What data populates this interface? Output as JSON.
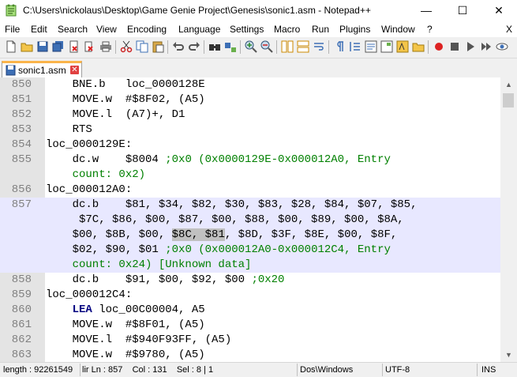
{
  "window": {
    "title": "C:\\Users\\nickolaus\\Desktop\\Game Genie Project\\Genesis\\sonic1.asm - Notepad++",
    "minimize": "—",
    "maximize": "☐",
    "close": "✕"
  },
  "menu": [
    "File",
    "Edit",
    "Search",
    "View",
    "Encoding",
    "Language",
    "Settings",
    "Macro",
    "Run",
    "Plugins",
    "Window",
    "?"
  ],
  "menu_close": "X",
  "tab": {
    "label": "sonic1.asm"
  },
  "lines": [
    {
      "n": "850",
      "parts": [
        {
          "t": "    BNE.b   loc_0000128E"
        }
      ]
    },
    {
      "n": "851",
      "parts": [
        {
          "t": "    MOVE.w  #$8F02, (A5)"
        }
      ]
    },
    {
      "n": "852",
      "parts": [
        {
          "t": "    MOVE.l  (A7)+, D1"
        }
      ]
    },
    {
      "n": "853",
      "parts": [
        {
          "t": "    RTS"
        }
      ]
    },
    {
      "n": "854",
      "parts": [
        {
          "t": "loc_0000129E:"
        }
      ]
    },
    {
      "n": "855",
      "parts": [
        {
          "t": "    dc.w    $8004 "
        },
        {
          "t": ";0x0 (0x0000129E-0x000012A0, Entry",
          "c": "cm"
        }
      ]
    },
    {
      "n": "",
      "parts": [
        {
          "t": "    count: 0x2)",
          "c": "cm"
        }
      ]
    },
    {
      "n": "856",
      "parts": [
        {
          "t": "loc_000012A0:"
        }
      ]
    },
    {
      "n": "857",
      "hl": true,
      "parts": [
        {
          "t": "    dc.b    $81, $34, $82, $30, $83, $28, $84, $07, $85,"
        }
      ]
    },
    {
      "n": "",
      "hl": true,
      "parts": [
        {
          "t": "     $7C, $86, $00, $87, $00, $88, $00, $89, $00, $8A,"
        }
      ]
    },
    {
      "n": "",
      "hl": true,
      "parts": [
        {
          "t": "    $00, $8B, $00, "
        },
        {
          "t": "$8C, $81",
          "c": "sel"
        },
        {
          "t": ", $8D, $3F, $8E, $00, $8F,"
        }
      ]
    },
    {
      "n": "",
      "hl": true,
      "parts": [
        {
          "t": "    $02, $90, $01 "
        },
        {
          "t": ";0x0 (0x000012A0-0x000012C4, Entry",
          "c": "cm"
        }
      ]
    },
    {
      "n": "",
      "hl": true,
      "parts": [
        {
          "t": "    count: 0x24) [Unknown data]",
          "c": "cm"
        }
      ]
    },
    {
      "n": "858",
      "parts": [
        {
          "t": "    dc.b    $91, $00, $92, $00 "
        },
        {
          "t": ";0x20",
          "c": "cm"
        }
      ]
    },
    {
      "n": "859",
      "parts": [
        {
          "t": "loc_000012C4:"
        }
      ]
    },
    {
      "n": "860",
      "parts": [
        {
          "t": "    "
        },
        {
          "t": "LEA",
          "c": "kw"
        },
        {
          "t": " loc_00C00004, A5"
        }
      ]
    },
    {
      "n": "861",
      "parts": [
        {
          "t": "    MOVE.w  #$8F01, (A5)"
        }
      ]
    },
    {
      "n": "862",
      "parts": [
        {
          "t": "    MOVE.l  #$940F93FF, (A5)"
        }
      ]
    },
    {
      "n": "863",
      "parts": [
        {
          "t": "    MOVE.w  #$9780, (A5)"
        }
      ]
    }
  ],
  "status": {
    "length": "length : 92261549",
    "position": "lir Ln : 857    Col : 131    Sel : 8 | 1",
    "eol": "Dos\\Windows",
    "encoding": "UTF-8",
    "mode": "INS"
  },
  "colors": {
    "tab_accent": "#fab44b",
    "highlight_line": "#e8e8ff",
    "comment": "#008000",
    "keyword": "#000080",
    "gutter": "#e4e4e4"
  }
}
